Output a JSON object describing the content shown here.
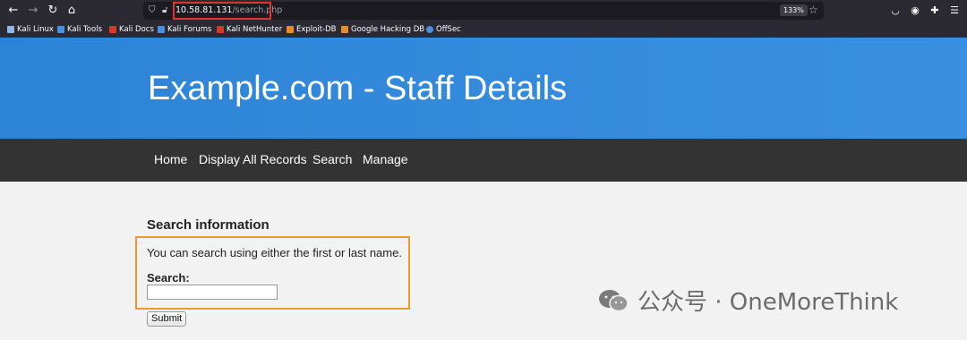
{
  "browser": {
    "url_host": "10.58.81.131",
    "url_path": "/search.php",
    "zoom": "133%",
    "bookmarks": [
      {
        "label": "Kali Linux",
        "color": "#8fb9e8"
      },
      {
        "label": "Kali Tools",
        "color": "#4a8fe0"
      },
      {
        "label": "Kali Docs",
        "color": "#d33a2c"
      },
      {
        "label": "Kali Forums",
        "color": "#4a8fe0"
      },
      {
        "label": "Kali NetHunter",
        "color": "#d33a2c"
      },
      {
        "label": "Exploit-DB",
        "color": "#e88b2e"
      },
      {
        "label": "Google Hacking DB",
        "color": "#e88b2e"
      },
      {
        "label": "OffSec",
        "color": "#4a8fe0"
      }
    ],
    "icons": {
      "back": "arrow-left-icon",
      "forward": "arrow-right-icon",
      "reload": "reload-icon",
      "home": "home-icon",
      "shield": "shield-icon",
      "lock": "lock-icon",
      "star": "star-icon",
      "pocket": "pocket-icon",
      "account": "account-icon",
      "extensions": "extensions-icon",
      "menu": "menu-icon"
    },
    "highlight_color": "#e0352b"
  },
  "page": {
    "title": "Example.com - Staff Details",
    "nav": [
      "Home",
      "Display All Records",
      "Search",
      "Manage"
    ],
    "section_title": "Search information",
    "description": "You can search using either the first or last name.",
    "search_label": "Search:",
    "search_value": "",
    "submit_label": "Submit",
    "box_color": "#f09a25",
    "header_color": "#2f87d8",
    "nav_color": "#333333"
  },
  "brand": {
    "text": "公众号 · OneMoreThink"
  }
}
